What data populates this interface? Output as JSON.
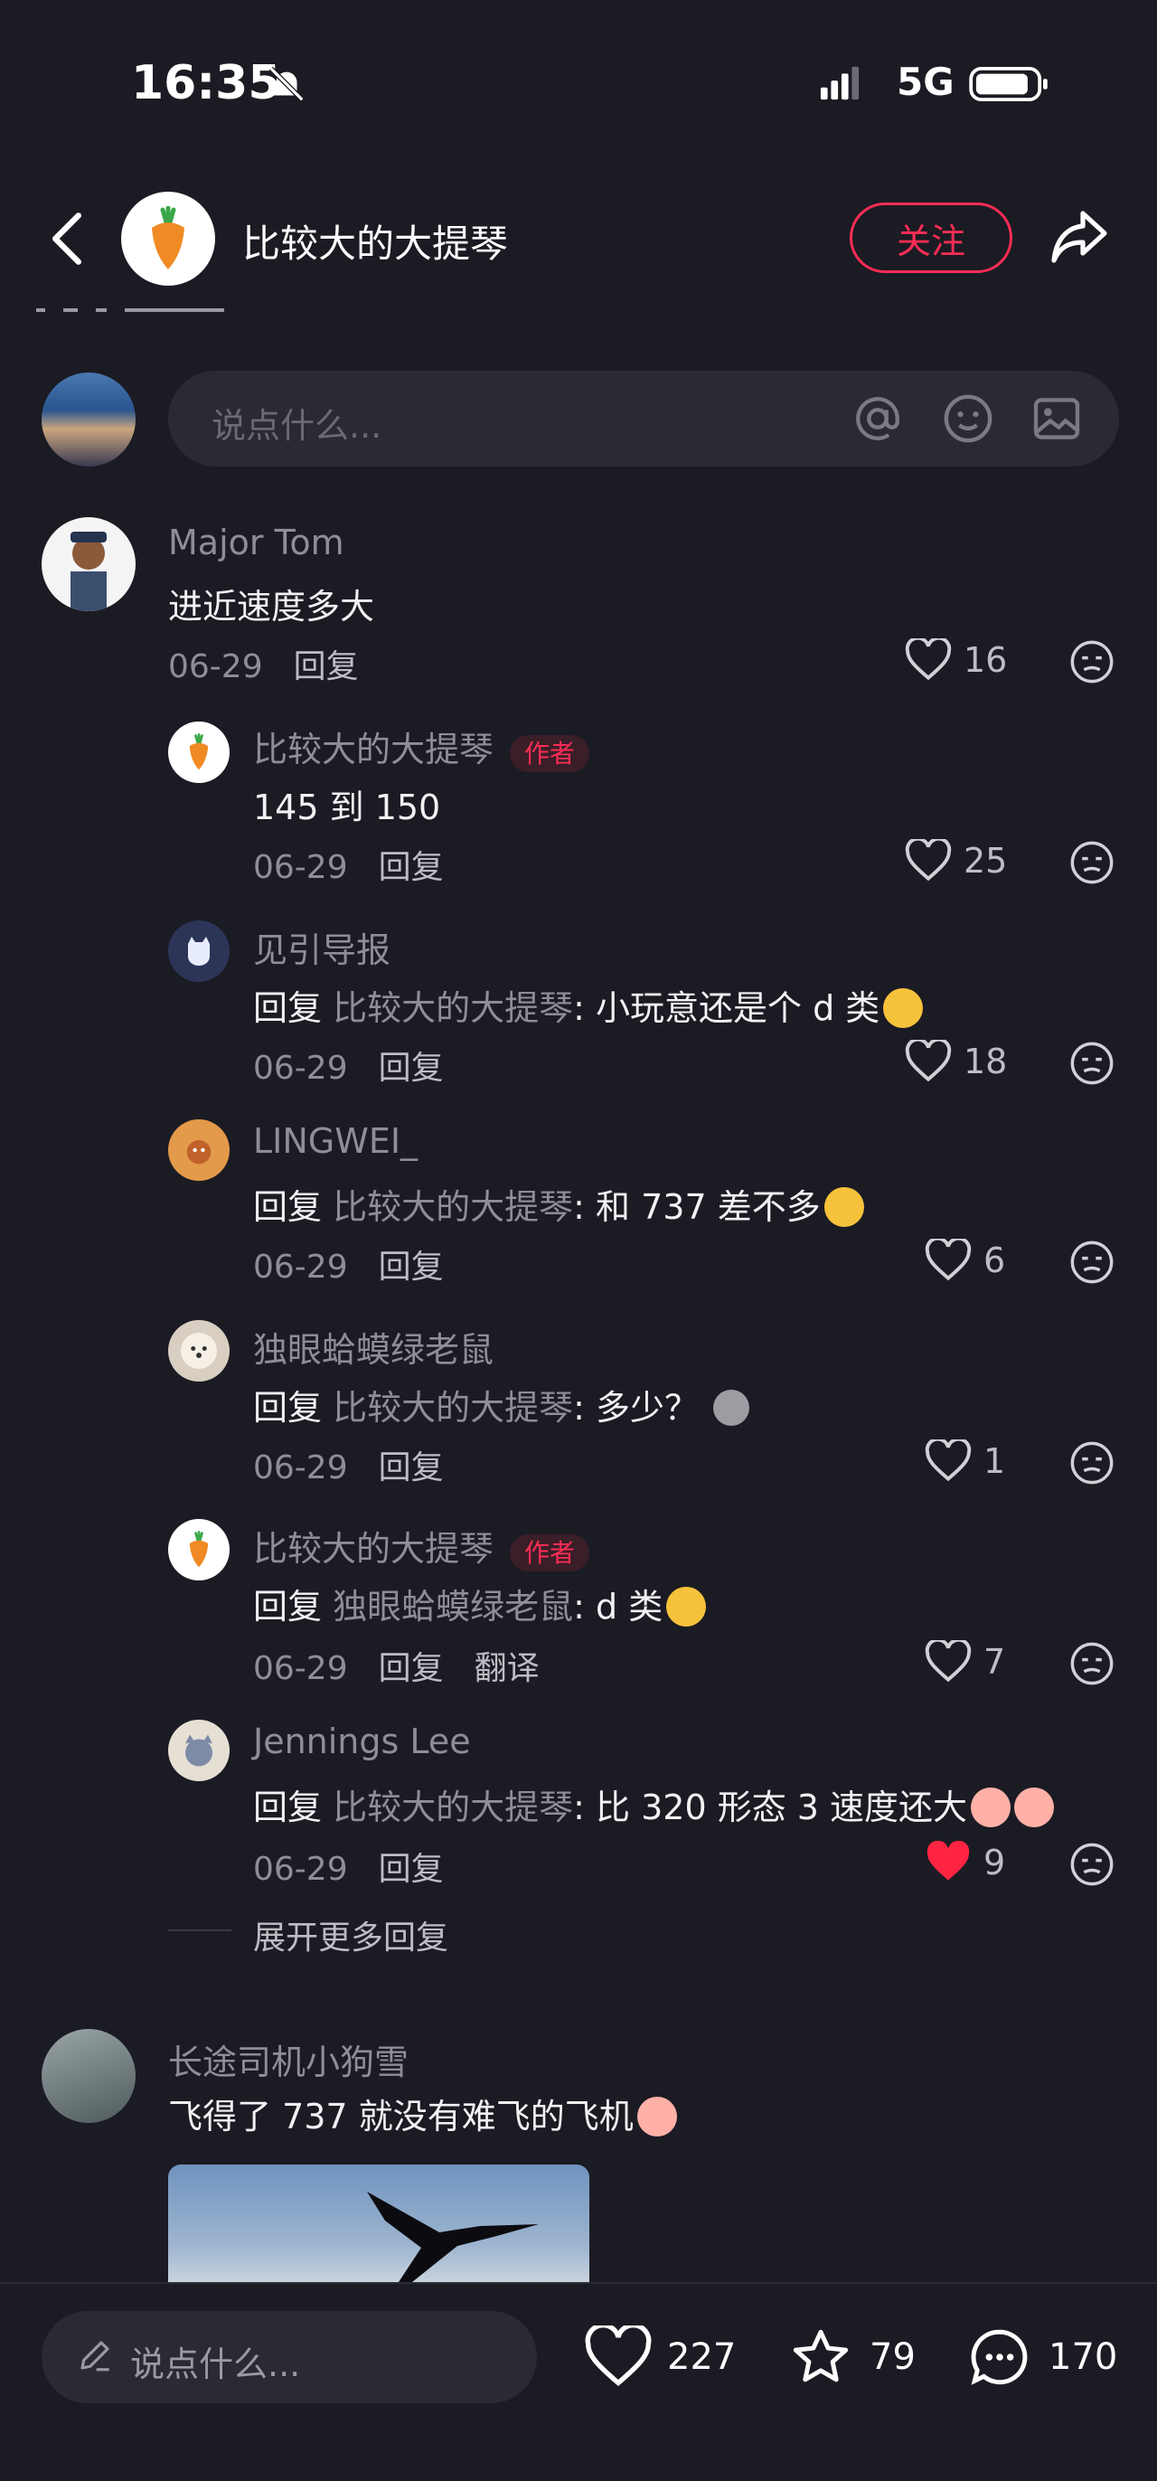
{
  "status_bar": {
    "time": "16:35",
    "network": "5G"
  },
  "header": {
    "author_name": "比较大的大提琴",
    "follow_label": "关注"
  },
  "composer": {
    "placeholder": "说点什么..."
  },
  "comments": [
    {
      "user": "Major Tom",
      "text": "进近速度多大",
      "date": "06-29",
      "reply_label": "回复",
      "likes": "16",
      "replies": [
        {
          "user": "比较大的大提琴",
          "badge": "作者",
          "text": "145 到 150",
          "date": "06-29",
          "reply_label": "回复",
          "likes": "25"
        },
        {
          "user": "见引导报",
          "prefix": "回复",
          "target": "比较大的大提琴",
          "text": ": 小玩意还是个 d 类",
          "date": "06-29",
          "reply_label": "回复",
          "likes": "18"
        },
        {
          "user": "LINGWEI_",
          "prefix": "回复",
          "target": "比较大的大提琴",
          "text": ": 和 737 差不多",
          "date": "06-29",
          "reply_label": "回复",
          "likes": "6"
        },
        {
          "user": "独眼蛤蟆绿老鼠",
          "prefix": "回复",
          "target": "比较大的大提琴",
          "text": ": 多少？",
          "date": "06-29",
          "reply_label": "回复",
          "likes": "1"
        },
        {
          "user": "比较大的大提琴",
          "badge": "作者",
          "prefix": "回复",
          "target": "独眼蛤蟆绿老鼠",
          "text": ": d 类",
          "date": "06-29",
          "reply_label": "回复",
          "translate_label": "翻译",
          "likes": "7"
        },
        {
          "user": "Jennings Lee",
          "prefix": "回复",
          "target": "比较大的大提琴",
          "text": ": 比 320 形态 3 速度还大",
          "date": "06-29",
          "reply_label": "回复",
          "likes": "9",
          "liked": true
        }
      ],
      "expand_label": "展开更多回复"
    },
    {
      "user": "长途司机小狗雪",
      "text": "飞得了 737  就没有难飞的飞机"
    }
  ],
  "bottom_bar": {
    "placeholder": "说点什么...",
    "likes": "227",
    "favorites": "79",
    "comments": "170"
  },
  "colors": {
    "accent": "#ff2d55",
    "background": "#1b1b23",
    "liked_heart": "#ff2442"
  }
}
